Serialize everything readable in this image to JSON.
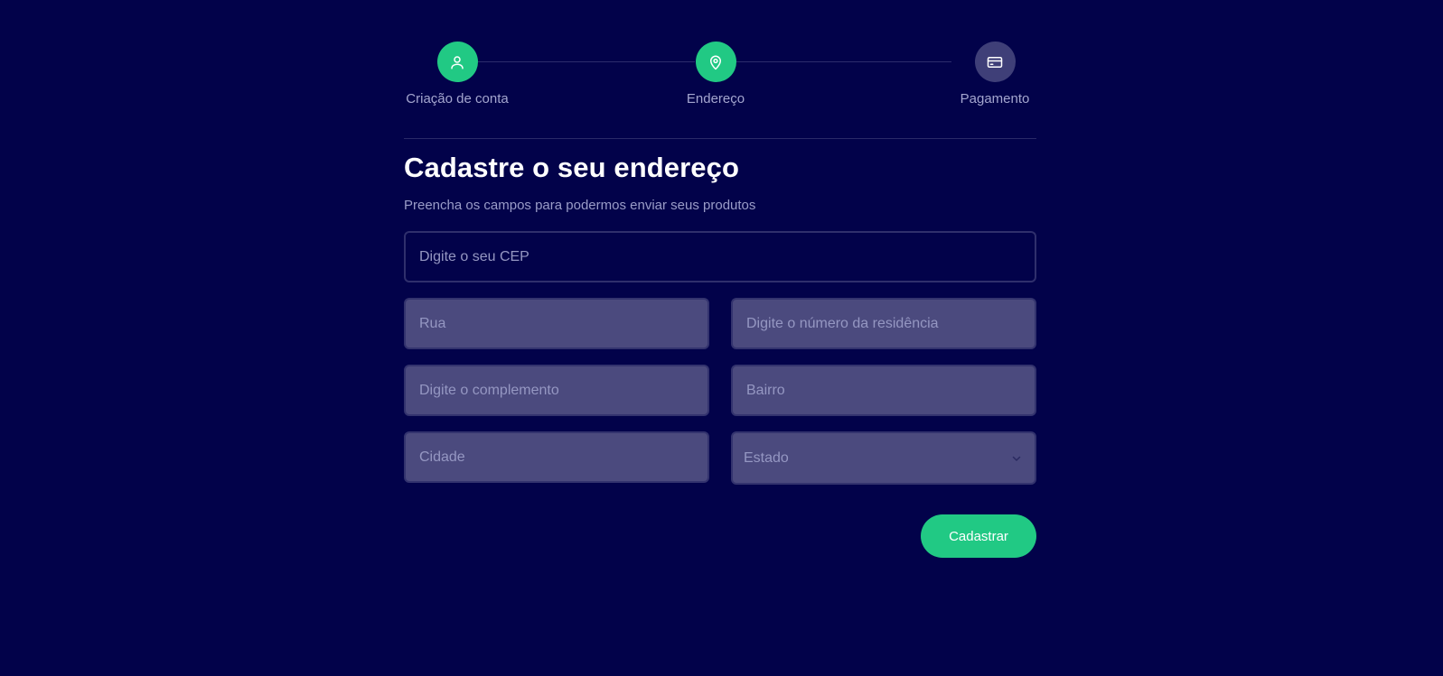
{
  "stepper": {
    "steps": [
      {
        "label": "Criação de conta",
        "icon": "user-icon",
        "state": "completed"
      },
      {
        "label": "Endereço",
        "icon": "map-pin-icon",
        "state": "current"
      },
      {
        "label": "Pagamento",
        "icon": "credit-card-icon",
        "state": "pending"
      }
    ]
  },
  "form": {
    "title": "Cadastre o seu endereço",
    "subtitle": "Preencha os campos para podermos enviar seus produtos",
    "cep_placeholder": "Digite o seu CEP",
    "rua_placeholder": "Rua",
    "numero_placeholder": "Digite o número da residência",
    "complemento_placeholder": "Digite o complemento",
    "bairro_placeholder": "Bairro",
    "cidade_placeholder": "Cidade",
    "estado_selected": "Estado",
    "submit_label": "Cadastrar"
  },
  "colors": {
    "background": "#02024a",
    "accent": "#21c984",
    "input_filled": "#4b4a7e",
    "step_inactive": "#3f3f78"
  }
}
